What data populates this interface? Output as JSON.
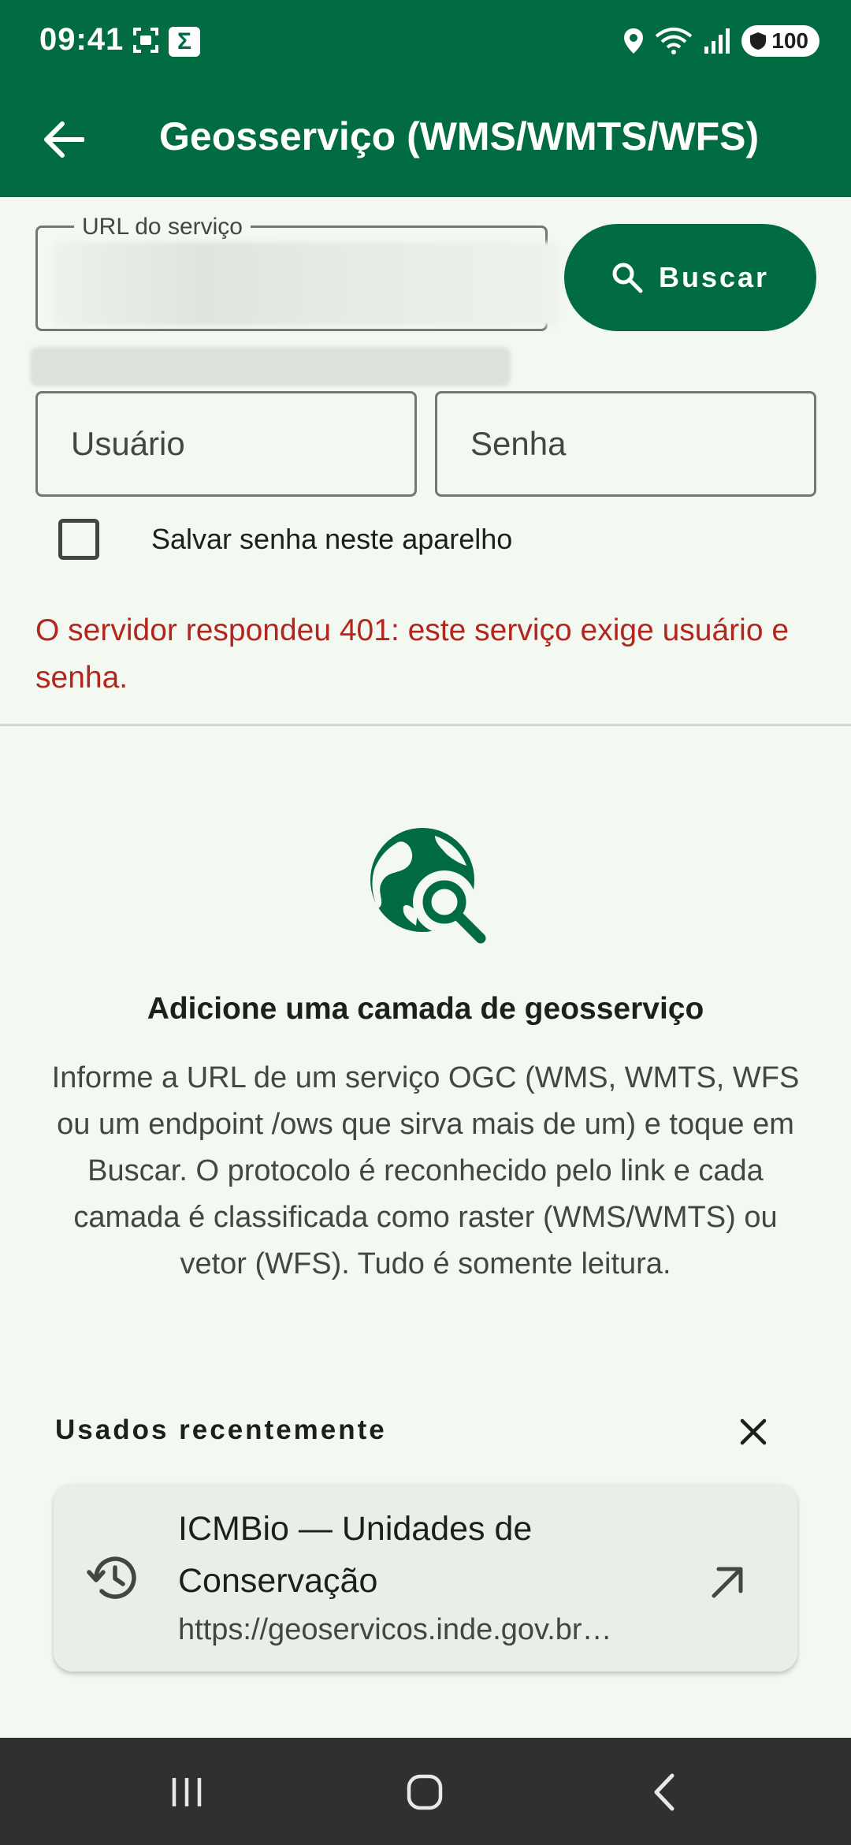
{
  "status_bar": {
    "time": "09:41",
    "notification_icon_a": "screenshot-icon",
    "notification_icon_b": "sigma-app-icon",
    "sigma_glyph": "Σ",
    "battery_level": "100",
    "colors": {
      "background": "#016b42"
    }
  },
  "app_bar": {
    "title": "Geosserviço (WMS/WMTS/WFS)",
    "back_icon": "arrow-left-icon",
    "colors": {
      "background": "#016b42",
      "foreground": "#ffffff"
    }
  },
  "form": {
    "url_label": "URL do serviço",
    "search_button_label": "Buscar",
    "search_icon": "search-icon",
    "username_placeholder": "Usuário",
    "password_placeholder": "Senha",
    "save_password_label": "Salvar senha neste aparelho",
    "save_password_checked": false,
    "error_message": "O servidor respondeu 401: este serviço exige usuário e senha."
  },
  "empty_state": {
    "icon": "travel-explore-icon",
    "title": "Adicione uma camada de geosserviço",
    "description": "Informe a URL de um serviço OGC (WMS, WMTS, WFS ou um endpoint /ows que sirva mais de um) e toque em Buscar. O protocolo é reconhecido pelo link e cada camada é classificada como raster (WMS/WMTS) ou vetor (WFS). Tudo é somente leitura."
  },
  "recent": {
    "header": "Usados recentemente",
    "clear_icon": "close-icon",
    "items": [
      {
        "name": "ICMBio — Unidades de Conservação",
        "url": "https://geoservicos.inde.gov.br…",
        "icon": "history-icon",
        "action_icon": "arrow-outward-icon"
      }
    ]
  },
  "nav_bar": {
    "recents_icon": "recent-apps-icon",
    "home_icon": "home-icon",
    "back_icon": "back-icon"
  },
  "colors": {
    "primary": "#016b42",
    "error": "#b3261e",
    "surface": "#f3f8f1"
  }
}
